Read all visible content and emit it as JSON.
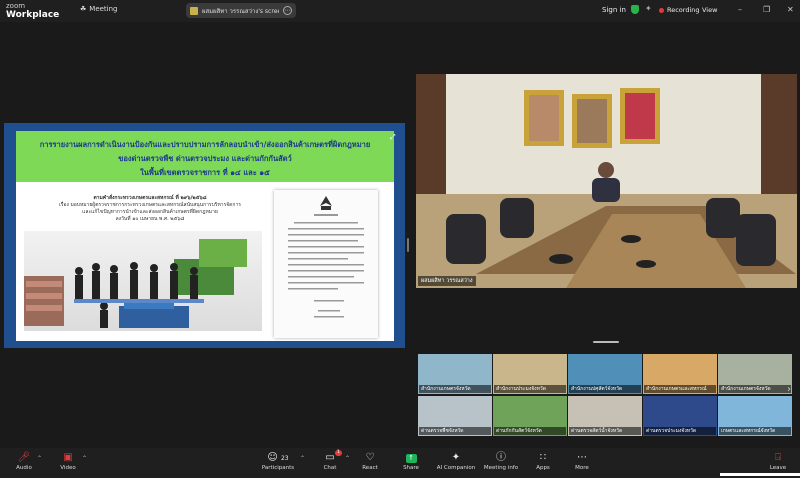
{
  "topbar": {
    "brand_line1": "zoom",
    "brand_line2": "Workplace",
    "meeting_label": "Meeting",
    "share_pill_text": "ผสมผสิทา วรรณสว่าง's screen",
    "sign_in": "Sign in",
    "recording": "Recording",
    "view": "View"
  },
  "slide": {
    "title_lines": [
      "การรายงานผลการดำเนินงานป้องกันและปราบปรามการลักลอบนำเข้า/ส่งออกสินค้าเกษตรที่ผิดกฎหมาย",
      "ของด่านตรวจพืช  ด่านตรวจประมง  และด่านกักกันสัตว์",
      "ในพื้นที่เขตตรวจราชการ ที่ ๑๔ และ ๑๕"
    ],
    "order_lines": [
      "ตามคำสั่งกระทรวงเกษตรและสหกรณ์ ที่ ๒๙๖/๒๕๖๘",
      "เรื่อง มอบหมายผู้ตรวจราชการกระทรวงเกษตรและสหกรณ์สนับสนุนการบริหารจัดการ",
      "และแก้ไขปัญหาการนำเข้าและส่งออกสินค้าเกษตรที่ผิดกฎหมาย",
      "ลงวันที่ ๑๐ เมษายน พ.ศ. ๒๕๖๘"
    ]
  },
  "speaker": {
    "name": "ผสมผสิทา วรรณสว่าง"
  },
  "gallery": [
    {
      "label": "สำนักงานเกษตรจังหวัด"
    },
    {
      "label": "สำนักงานประมงจังหวัด"
    },
    {
      "label": "สำนักงานปศุสัตว์จังหวัด"
    },
    {
      "label": "สำนักงานเกษตรและสหกรณ์"
    },
    {
      "label": "สำนักงานเกษตรจังหวัด"
    },
    {
      "label": "ด่านตรวจพืชจังหวัด"
    },
    {
      "label": "ด่านกักกันสัตว์จังหวัด"
    },
    {
      "label": "ด่านตรวจสัตว์น้ำจังหวัด"
    },
    {
      "label": "ด่านตรวจประมงจังหวัด"
    },
    {
      "label": "เกษตรและสหกรณ์จังหวัด"
    }
  ],
  "toolbar": {
    "audio": "Audio",
    "video": "Video",
    "participants": "Participants",
    "participants_count": "23",
    "chat": "Chat",
    "chat_badge": "1",
    "react": "React",
    "share": "Share",
    "ai_companion": "AI Companion",
    "meeting_info": "Meeting info",
    "apps": "Apps",
    "more": "More",
    "leave": "Leave"
  },
  "icons": {
    "audio": "microphone-muted-icon",
    "video": "camera-off-icon",
    "participants": "people-icon",
    "chat": "chat-bubble-icon",
    "react": "heart-icon",
    "share": "share-arrow-icon",
    "ai": "sparkle-icon",
    "info": "info-icon",
    "apps": "apps-icon",
    "more": "ellipsis-icon",
    "leave": "leave-door-icon"
  },
  "colors": {
    "slide_header_green": "#7ed957",
    "slide_border_blue": "#1f4f8e",
    "share_green": "#1fb45a",
    "record_red": "#e23b3b",
    "muted_red": "#e23b3b"
  }
}
